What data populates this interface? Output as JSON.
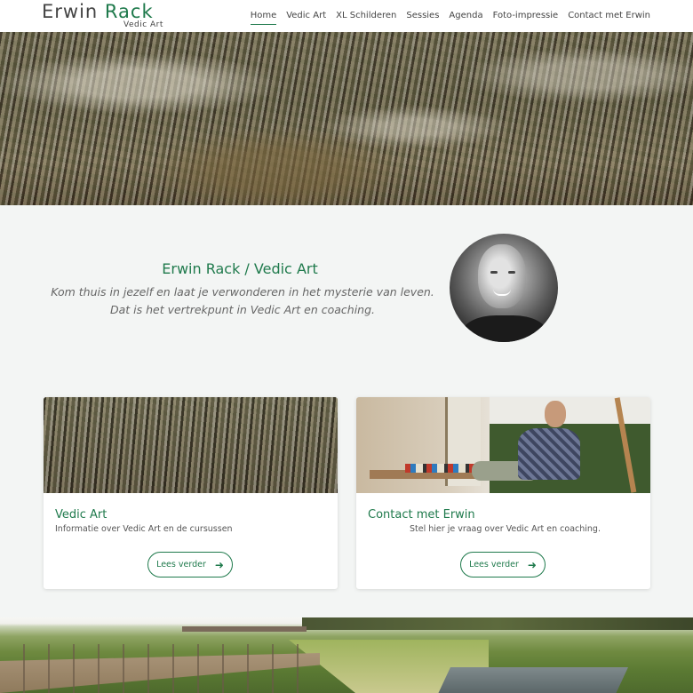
{
  "brand": {
    "name_part1": "Erwin ",
    "name_part2": "Rack",
    "tagline": "Vedic Art",
    "accent_color": "#1f7a4c"
  },
  "nav": {
    "items": [
      {
        "label": "Home",
        "active": true
      },
      {
        "label": "Vedic Art",
        "active": false
      },
      {
        "label": "XL Schilderen",
        "active": false
      },
      {
        "label": "Sessies",
        "active": false
      },
      {
        "label": "Agenda",
        "active": false
      },
      {
        "label": "Foto-impressie",
        "active": false
      },
      {
        "label": "Contact met Erwin",
        "active": false
      }
    ]
  },
  "intro": {
    "title": "Erwin Rack / Vedic Art",
    "line1": "Kom thuis in jezelf en laat je verwonderen in het mysterie van leven.",
    "line2": "Dat is het vertrekpunt in Vedic Art en coaching."
  },
  "cards": [
    {
      "title": "Vedic Art",
      "subtitle": "Informatie over Vedic Art en de cursussen",
      "button_label": "Lees verder",
      "button_icon": "arrow-right-icon"
    },
    {
      "title": "Contact met Erwin",
      "subtitle": "Stel hier je vraag over Vedic Art en coaching.",
      "button_label": "Lees verder",
      "button_icon": "arrow-right-icon"
    }
  ]
}
